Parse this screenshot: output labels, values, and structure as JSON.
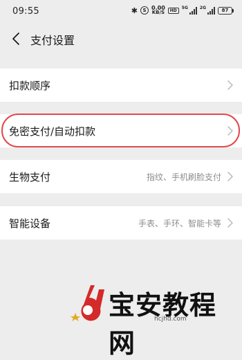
{
  "status_bar": {
    "time": "09:55",
    "speed_value": "0.00",
    "speed_unit": "KB/S",
    "hd_label": "HD",
    "net1": "5G",
    "net2": "2G",
    "battery": "87"
  },
  "header": {
    "title": "支付设置"
  },
  "rows": [
    {
      "label": "扣款顺序",
      "value": ""
    },
    {
      "label": "免密支付/自动扣款",
      "value": ""
    },
    {
      "label": "生物支付",
      "value": "指纹、手机刷脸支付"
    },
    {
      "label": "智能设备",
      "value": "手表、手环、智能卡等"
    }
  ],
  "watermark": {
    "text": "宝安教程网",
    "url": "hcjhd.com"
  },
  "colors": {
    "background": "#ededed",
    "highlight": "#e0484b",
    "logo_red": "#d42a2a"
  }
}
